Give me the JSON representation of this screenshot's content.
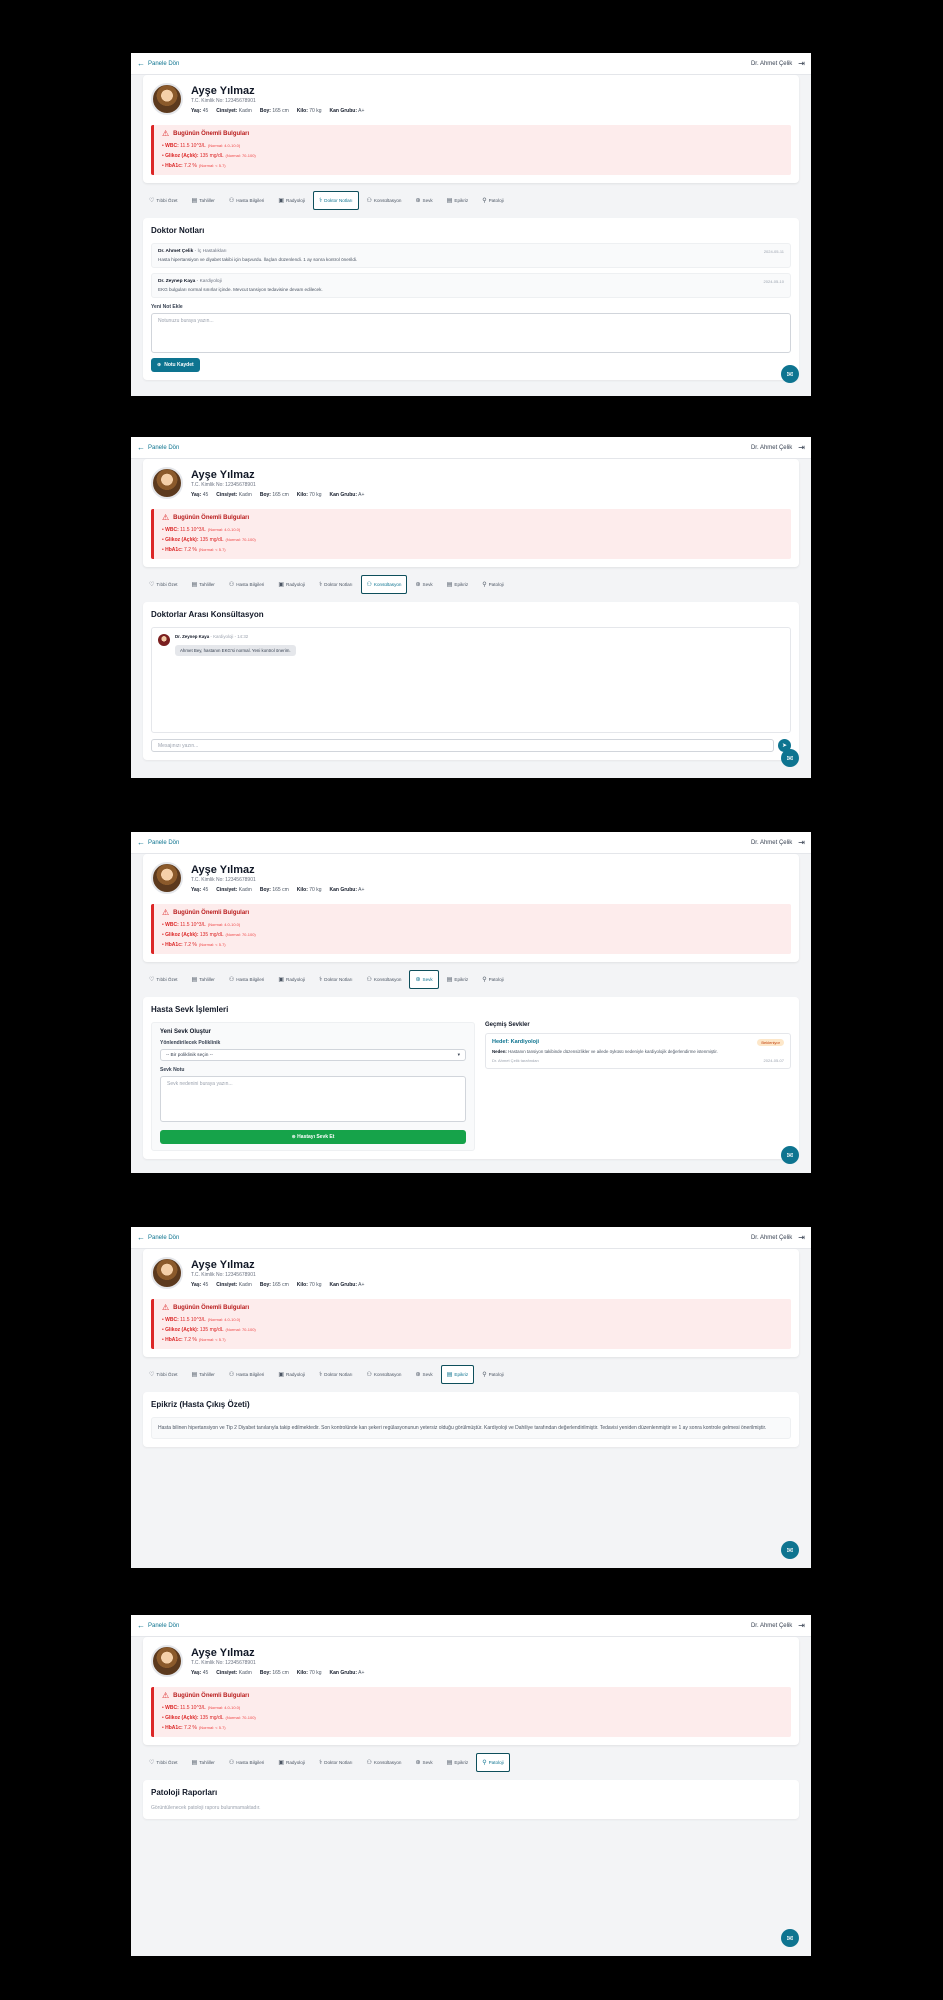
{
  "topbar": {
    "back": "Panele Dön",
    "user": "Dr. Ahmet Çelik"
  },
  "patient": {
    "name": "Ayşe Yılmaz",
    "tc": "T.C. Kimlik No: 12345678901",
    "stats": [
      {
        "label": "Yaş:",
        "value": "45"
      },
      {
        "label": "Cinsiyet:",
        "value": "Kadın"
      },
      {
        "label": "Boy:",
        "value": "165 cm"
      },
      {
        "label": "Kilo:",
        "value": "70 kg"
      },
      {
        "label": "Kan Grubu:",
        "value": "A+"
      }
    ]
  },
  "alert": {
    "title": "Bugünün Önemli Bulguları",
    "items": [
      {
        "label": "WBC:",
        "value": "11.5 10^3/L",
        "norm": "(Normal: 4.0-10.0)"
      },
      {
        "label": "Glikoz (Açlık):",
        "value": "135 mg/dL",
        "norm": "(Normal: 70-100)"
      },
      {
        "label": "HbA1c:",
        "value": "7.2 %",
        "norm": "(Normal: < 5.7)"
      }
    ]
  },
  "tabs": [
    "Tıbbi Özet",
    "Tahliller",
    "Hasta Bilgileri",
    "Radyoloji",
    "Doktor Notları",
    "Konsültasyon",
    "Sevk",
    "Epikriz",
    "Patoloji"
  ],
  "notes": {
    "title": "Doktor Notları",
    "items": [
      {
        "name": "Dr. Ahmet Çelik",
        "role": "- İç Hastalıkları",
        "date": "2024-05-11",
        "text": "Hasta hipertansiyon ve diyabet takibi için başvurdu. İlaçları düzenlendi. 1 ay sonra kontrol önerildi."
      },
      {
        "name": "Dr. Zeynep Kaya",
        "role": "- Kardiyoloji",
        "date": "2024-05-10",
        "text": "EKG bulguları normal sınırlar içinde. Mevcut tansiyon tedavisine devam edilecek."
      }
    ],
    "new_label": "Yeni Not Ekle",
    "placeholder": "Notunuzu buraya yazın...",
    "save": "Notu Kaydet"
  },
  "consult": {
    "title": "Doktorlar Arası Konsültasyon",
    "msg_name": "Dr. Zeynep Kaya",
    "msg_meta": "- Kardiyoloji - 14:32",
    "msg_text": "Ahmet Bey, hastanın EKG'si normal. Yeni kontrol önerim.",
    "placeholder": "Mesajınızı yazın..."
  },
  "referral": {
    "title": "Hasta Sevk İşlemleri",
    "new_title": "Yeni Sevk Oluştur",
    "dept_label": "Yönlendirilecek Poliklinik",
    "dept_value": "-- Bir poliklinik seçin --",
    "reason_label": "Sevk Notu",
    "reason_placeholder": "Sevk nedenini buraya yazın...",
    "submit": "Hastayı Sevk Et",
    "past_title": "Geçmiş Sevkler",
    "past_target": "Hedef: Kardiyoloji",
    "past_badge": "Bekleniyor",
    "past_reason_label": "Neden:",
    "past_reason": "Hastanın tansiyon takibinde düzensizlikler ve ailede öyküsü nedeniyle kardiyolojik değerlendirme istenmiştir.",
    "past_from": "Dr. Ahmet Çelik tarafından",
    "past_date": "2024-05-07"
  },
  "epicrisis": {
    "title": "Epikriz (Hasta Çıkış Özeti)",
    "text": "Hasta bilinen hipertansiyon ve Tip 2 Diyabet tanılarıyla takip edilmektedir. Son kontrolünde kan şekeri regülasyonunun yetersiz olduğu görülmüştür. Kardiyoloji ve Dahiliye tarafından değerlendirilmiştir. Tedavisi yeniden düzenlenmiştir ve 1 ay sonra kontrole gelmesi önerilmiştir."
  },
  "pathology": {
    "title": "Patoloji Raporları",
    "empty": "Görüntülenecek patoloji raporu bulunmamaktadır."
  }
}
